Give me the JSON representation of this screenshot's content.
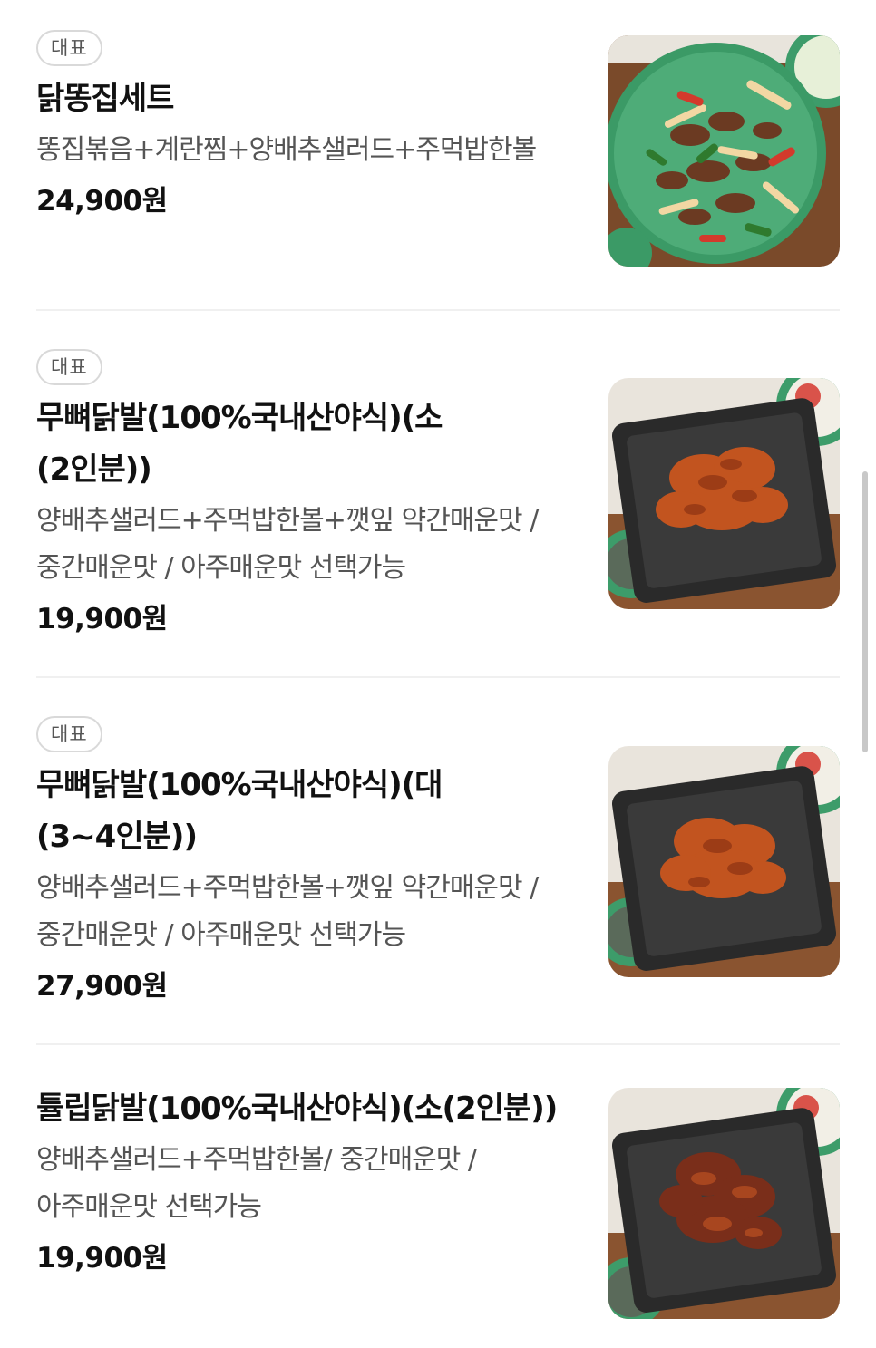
{
  "menu_items": [
    {
      "badge": "대표",
      "name": "닭똥집세트",
      "description": "똥집볶음+계란찜+양배추샐러드+주먹밥한볼",
      "price": "24,900원"
    },
    {
      "badge": "대표",
      "name": "무뼈닭발(100%국내산야식)(소 (2인분))",
      "description": "양배추샐러드+주먹밥한볼+깻잎 약간매운맛 / 중간매운맛 / 아주매운맛 선택가능",
      "price": "19,900원"
    },
    {
      "badge": "대표",
      "name": "무뼈닭발(100%국내산야식)(대 (3~4인분))",
      "description": "양배추샐러드+주먹밥한볼+깻잎 약간매운맛 / 중간매운맛 / 아주매운맛 선택가능",
      "price": "27,900원"
    },
    {
      "name": "튤립닭발(100%국내산야식)(소(2인분))",
      "description": "양배추샐러드+주먹밥한볼/ 중간매운맛 / 아주매운맛 선택가능",
      "price": "19,900원"
    }
  ],
  "colors": {
    "badge_border": "#d9d9d9",
    "text_primary": "#111111",
    "text_secondary": "#555555",
    "divider": "#f0f0f0"
  }
}
